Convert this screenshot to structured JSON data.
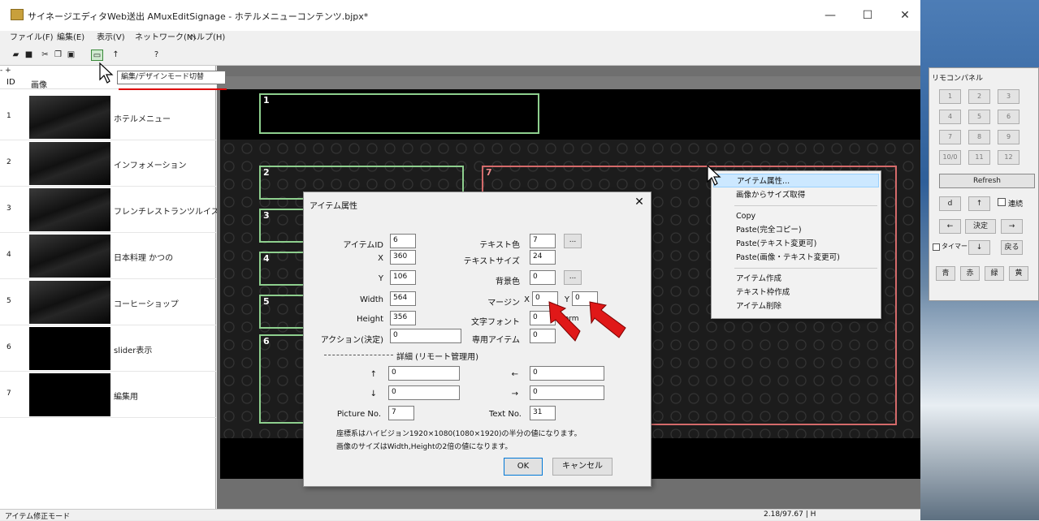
{
  "window": {
    "title": "サイネージエディタWeb送出 AMuxEditSignage - ホテルメニューコンテンツ.bjpx*",
    "minimize": "—",
    "maximize": "☐",
    "close": "✕"
  },
  "menu": [
    "ファイル(F)",
    "編集(E)",
    "表示(V)",
    "ネットワーク(N)",
    "ヘルプ(H)"
  ],
  "toolbar": {
    "tooltip": "編集/デザインモード切替"
  },
  "list": {
    "collapse": "- +",
    "headers": {
      "id": "ID",
      "image": "画像"
    },
    "rows": [
      {
        "id": "1",
        "name": "ホテルメニュー"
      },
      {
        "id": "2",
        "name": "インフォメーション"
      },
      {
        "id": "3",
        "name": "フレンチレストランツルイス"
      },
      {
        "id": "4",
        "name": "日本料理 かつの"
      },
      {
        "id": "5",
        "name": "コーヒーショップ"
      },
      {
        "id": "6",
        "name": "slider表示"
      },
      {
        "id": "7",
        "name": "編集用"
      }
    ]
  },
  "canvas": {
    "items": [
      "1",
      "2",
      "3",
      "4",
      "5",
      "6",
      "7"
    ]
  },
  "status": {
    "mode": "アイテム修正モード",
    "coords": "2.18/97.67 | H"
  },
  "dialog": {
    "title": "アイテム属性",
    "close": "✕",
    "fields": {
      "item_id": {
        "label": "アイテムID",
        "value": "6"
      },
      "x": {
        "label": "X",
        "value": "360"
      },
      "y": {
        "label": "Y",
        "value": "106"
      },
      "width": {
        "label": "Width",
        "value": "564"
      },
      "height": {
        "label": "Height",
        "value": "356"
      },
      "action": {
        "label": "アクション(決定)",
        "value": "0"
      },
      "text_color": {
        "label": "テキスト色",
        "value": "7"
      },
      "text_size": {
        "label": "テキストサイズ",
        "value": "24"
      },
      "bg_color": {
        "label": "背景色",
        "value": "0"
      },
      "margin": {
        "label": "マージン",
        "x_label": "X",
        "x_value": "0",
        "y_label": "Y",
        "y_value": "0"
      },
      "font": {
        "label": "文字フォント",
        "value": "0",
        "suffix": "Norm"
      },
      "special": {
        "label": "専用アイテム",
        "value": "0"
      },
      "browse": "..."
    },
    "remote_section": "詳細 (リモート管理用)",
    "remote_fields": {
      "up": {
        "label": "↑",
        "value": "0"
      },
      "left": {
        "label": "←",
        "value": "0"
      },
      "down": {
        "label": "↓",
        "value": "0"
      },
      "right": {
        "label": "→",
        "value": "0"
      },
      "picture_no": {
        "label": "Picture No.",
        "value": "7"
      },
      "text_no": {
        "label": "Text No.",
        "value": "31"
      }
    },
    "notes": [
      "座標系はハイビジョン1920×1080(1080×1920)の半分の値になります。",
      "画像のサイズはWidth,Heightの2倍の値になります。"
    ],
    "ok": "OK",
    "cancel": "キャンセル"
  },
  "context_menu": {
    "items": [
      "アイテム属性...",
      "画像からサイズ取得",
      "Copy",
      "Paste(完全コピー)",
      "Paste(テキスト変更可)",
      "Paste(画像・テキスト変更可)",
      "アイテム作成",
      "テキスト枠作成",
      "アイテム削除"
    ]
  },
  "remote_panel": {
    "title": "リモコンパネル",
    "keys": [
      "1",
      "2",
      "3",
      "4",
      "5",
      "6",
      "7",
      "8",
      "9",
      "10/0",
      "11",
      "12"
    ],
    "refresh": "Refresh",
    "d": "d",
    "up": "↑",
    "continuous": "連続",
    "left": "←",
    "enter": "決定",
    "right": "→",
    "timer": "タイマー",
    "down": "↓",
    "back": "戻る",
    "colors": [
      "青",
      "赤",
      "緑",
      "黄"
    ]
  }
}
